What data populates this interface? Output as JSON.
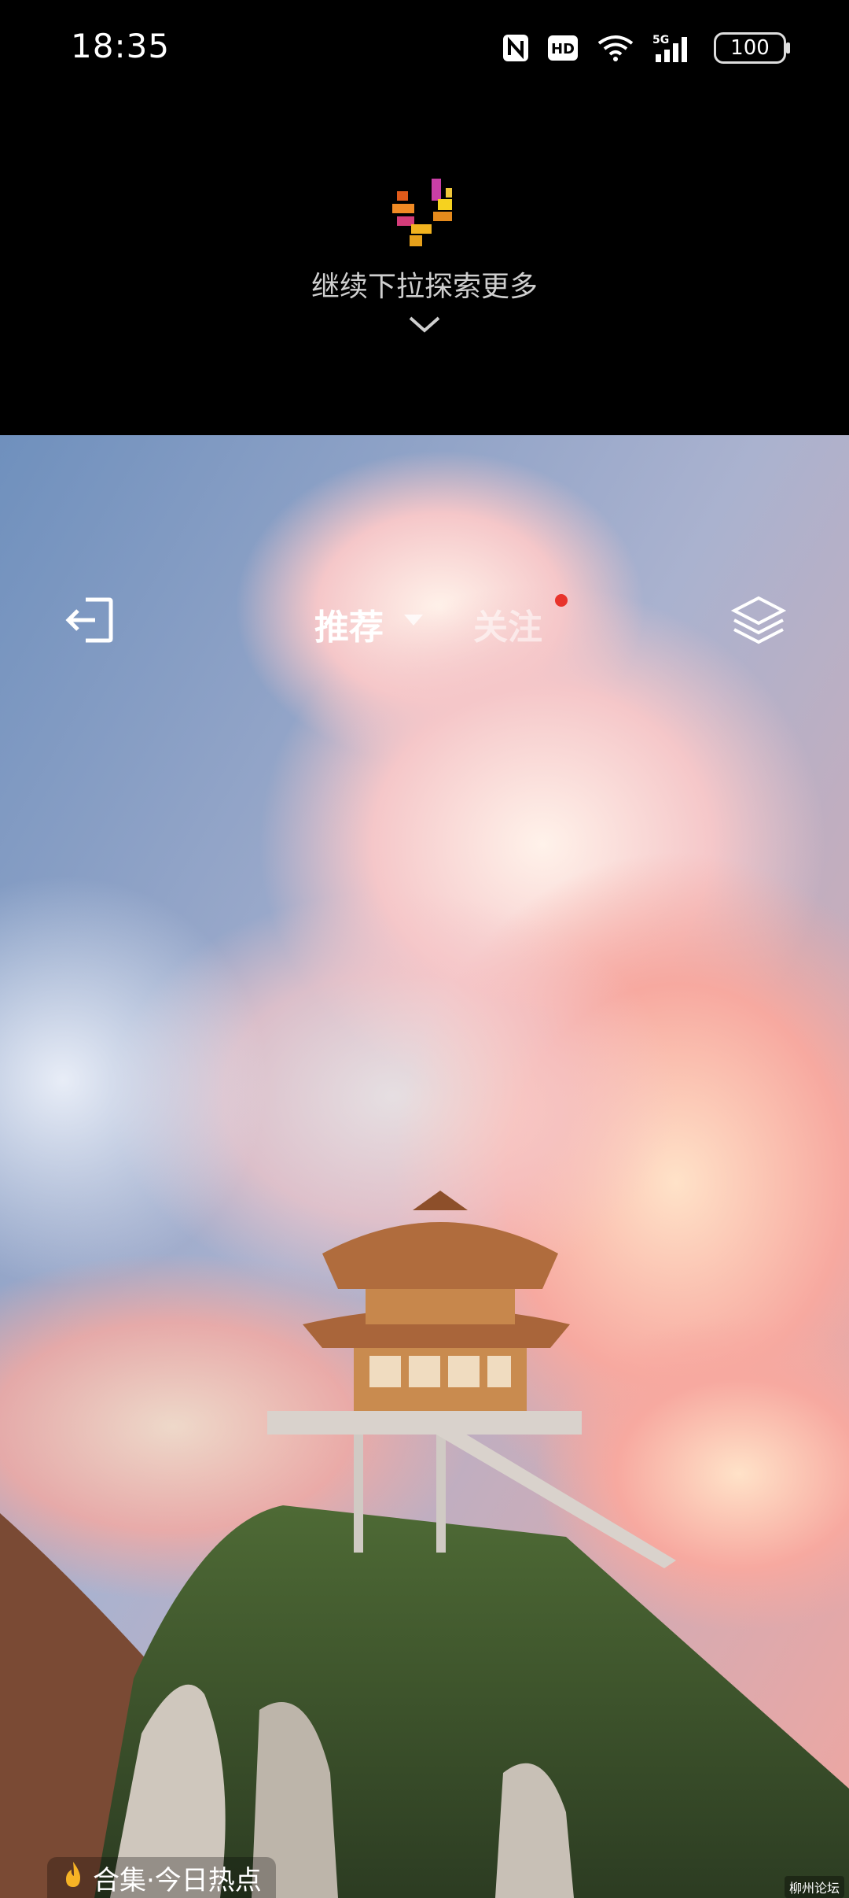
{
  "status_bar": {
    "time": "18:35",
    "icons": [
      "nfc-icon",
      "hd-icon",
      "wifi-icon",
      "signal-5g-icon"
    ],
    "battery": "100"
  },
  "pull_hint": {
    "text": "继续下拉探索更多"
  },
  "tabs": {
    "recommend": "推荐",
    "follow": "关注"
  },
  "collection": {
    "label": "合集·今日热点"
  },
  "watermark": "柳州论坛",
  "colors": {
    "background": "#000000",
    "notification_dot": "#e8332b",
    "tab_active": "#ffffff",
    "tab_inactive": "rgba(255,255,255,0.55)"
  }
}
